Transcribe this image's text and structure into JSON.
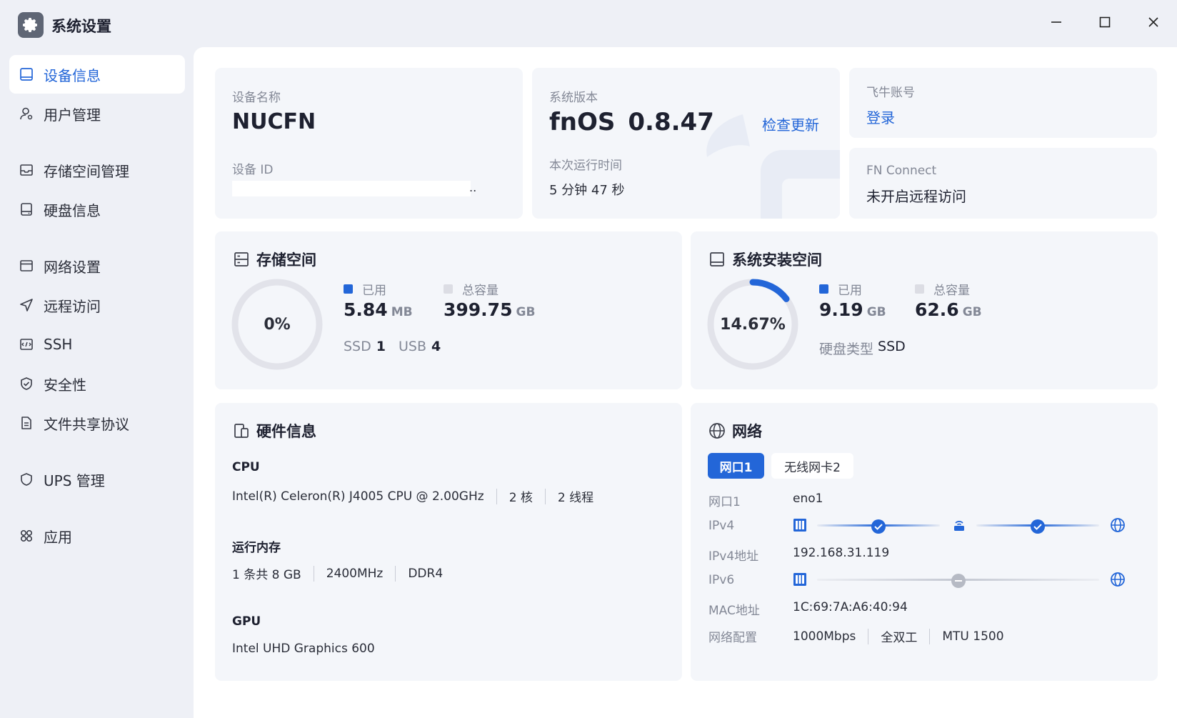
{
  "window": {
    "title": "系统设置",
    "controls": {
      "minimize": "minimize-icon",
      "maximize": "maximize-icon",
      "close": "close-icon"
    }
  },
  "sidebar": {
    "items": [
      {
        "label": "设备信息",
        "icon": "device-icon",
        "active": true
      },
      {
        "label": "用户管理",
        "icon": "user-icon"
      },
      {
        "label": "存储空间管理",
        "icon": "storage-icon"
      },
      {
        "label": "硬盘信息",
        "icon": "hard-disk-icon"
      },
      {
        "label": "网络设置",
        "icon": "network-settings-icon"
      },
      {
        "label": "远程访问",
        "icon": "remote-access-icon"
      },
      {
        "label": "SSH",
        "icon": "terminal-icon"
      },
      {
        "label": "安全性",
        "icon": "shield-check-icon"
      },
      {
        "label": "文件共享协议",
        "icon": "file-share-icon"
      },
      {
        "label": "UPS 管理",
        "icon": "ups-shield-icon"
      },
      {
        "label": "应用",
        "icon": "apps-icon"
      }
    ]
  },
  "device": {
    "name_label": "设备名称",
    "name": "NUCFN",
    "id_label": "设备 ID",
    "id_suffix": ".."
  },
  "system": {
    "version_label": "系统版本",
    "os": "fnOS",
    "version": "0.8.47",
    "check_update": "检查更新",
    "uptime_label": "本次运行时间",
    "uptime": "5 分钟 47 秒"
  },
  "account": {
    "label": "飞牛账号",
    "login": "登录"
  },
  "fnconnect": {
    "label": "FN Connect",
    "status": "未开启远程访问"
  },
  "storage": {
    "title": "存储空间",
    "percent": "0%",
    "used_fraction": 0,
    "used_label": "已用",
    "used_value": "5.84",
    "used_unit": "MB",
    "total_label": "总容量",
    "total_value": "399.75",
    "total_unit": "GB",
    "ssd_label": "SSD",
    "ssd_count": "1",
    "usb_label": "USB",
    "usb_count": "4"
  },
  "sysinstall": {
    "title": "系统安装空间",
    "percent": "14.67%",
    "used_fraction": 0.1467,
    "used_label": "已用",
    "used_value": "9.19",
    "used_unit": "GB",
    "total_label": "总容量",
    "total_value": "62.6",
    "total_unit": "GB",
    "disk_type_label": "硬盘类型",
    "disk_type": "SSD"
  },
  "hardware": {
    "title": "硬件信息",
    "cpu_label": "CPU",
    "cpu_model": "Intel(R) Celeron(R) J4005 CPU @ 2.00GHz",
    "cpu_cores": "2 核",
    "cpu_threads": "2 线程",
    "mem_label": "运行内存",
    "mem_size": "1 条共 8 GB",
    "mem_freq": "2400MHz",
    "mem_type": "DDR4",
    "gpu_label": "GPU",
    "gpu_model": "Intel UHD Graphics 600"
  },
  "network": {
    "title": "网络",
    "tabs": [
      "网口1",
      "无线网卡2"
    ],
    "active_tab": 0,
    "port_label": "网口1",
    "port": "eno1",
    "ipv4_label": "IPv4",
    "ipv4_addr_label": "IPv4地址",
    "ipv4_addr": "192.168.31.119",
    "ipv6_label": "IPv6",
    "mac_label": "MAC地址",
    "mac": "1C:69:7A:A6:40:94",
    "config_label": "网络配置",
    "speed": "1000Mbps",
    "duplex": "全双工",
    "mtu": "MTU 1500"
  },
  "colors": {
    "accent": "#2366d8",
    "ring_track": "#e2e3ea",
    "card_bg": "#f4f6fa",
    "muted": "#838896"
  }
}
